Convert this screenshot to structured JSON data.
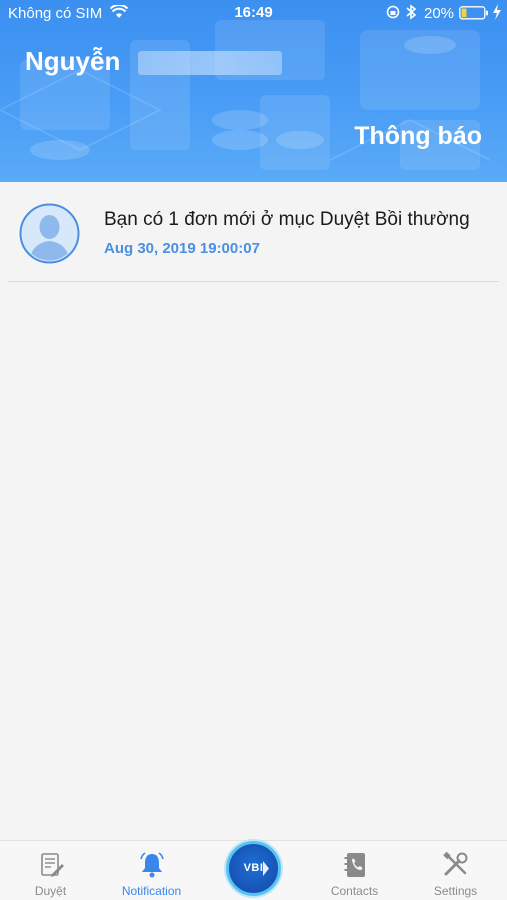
{
  "status_bar": {
    "carrier": "Không có SIM",
    "time": "16:49",
    "battery_percent": "20%",
    "icons": [
      "wifi-icon",
      "orientation-lock-icon",
      "bluetooth-icon",
      "battery-icon",
      "charging-icon"
    ]
  },
  "header": {
    "user_name": "Nguyễn",
    "title": "Thông báo"
  },
  "notifications": [
    {
      "message": "Bạn có 1 đơn mới ở mục Duyệt Bồi thường",
      "date": "Aug 30, 2019 19:00:07",
      "icon": "user-avatar-icon"
    }
  ],
  "tab_bar": {
    "tabs": [
      {
        "label": "Duyệt",
        "icon": "approve-document-icon",
        "active": false
      },
      {
        "label": "Notification",
        "icon": "bell-icon",
        "active": true
      },
      {
        "label": "VBI",
        "icon": "vbi-logo-icon",
        "active": false
      },
      {
        "label": "Contacts",
        "icon": "contacts-book-icon",
        "active": false
      },
      {
        "label": "Settings",
        "icon": "settings-tools-icon",
        "active": false
      }
    ]
  },
  "colors": {
    "header_blue": "#3b8ff0",
    "accent_blue": "#4a8fe2",
    "active_tab": "#3a86ea",
    "inactive_tab": "#8a8a8a",
    "background": "#f4f4f5"
  }
}
